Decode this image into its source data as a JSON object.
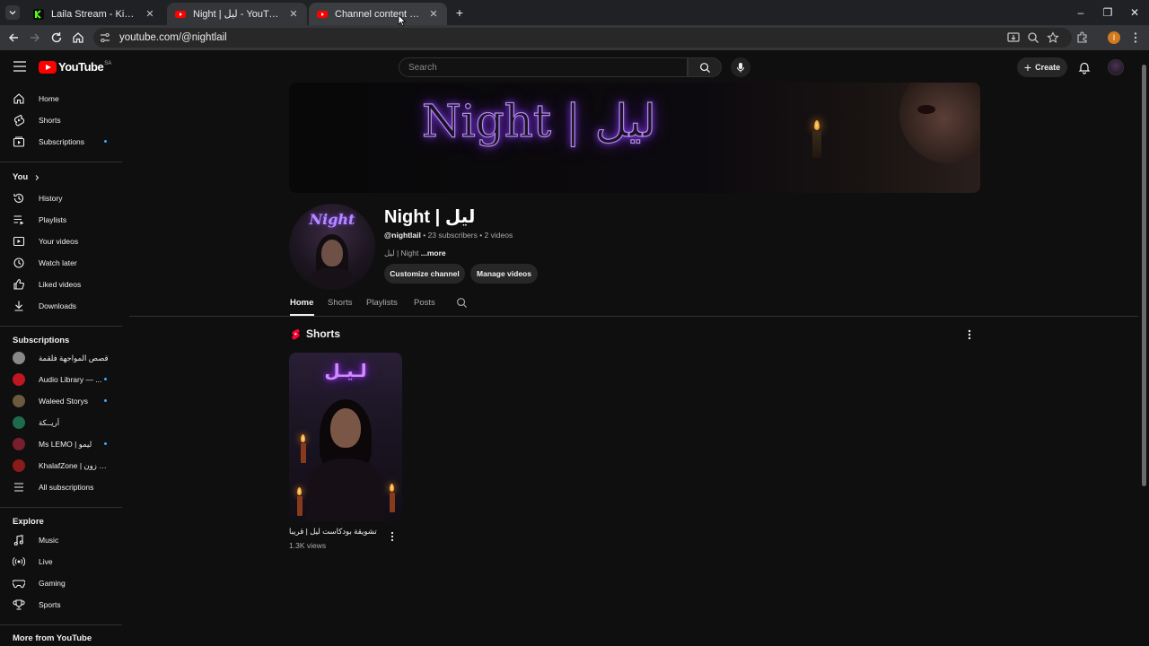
{
  "browser": {
    "tabs": [
      {
        "title": "Laila Stream - Kick Dashboard",
        "favicon": "kick-favicon",
        "color": "#53fc18"
      },
      {
        "title": "Night | ليل - YouTube",
        "favicon": "youtube-favicon",
        "color": "#ff0000"
      },
      {
        "title": "Channel content - YouTube Studio",
        "favicon": "youtube-studio-favicon",
        "color": "#ff0000"
      }
    ],
    "url": "youtube.com/@nightlail",
    "profile_initial": "I"
  },
  "masthead": {
    "logo_text": "YouTube",
    "country_code": "SA",
    "search_placeholder": "Search",
    "create_label": "Create"
  },
  "sidebar": {
    "main": [
      {
        "label": "Home",
        "icon": "home-icon"
      },
      {
        "label": "Shorts",
        "icon": "shorts-icon"
      },
      {
        "label": "Subscriptions",
        "icon": "subscriptions-icon"
      }
    ],
    "you_heading": "You",
    "you": [
      {
        "label": "History",
        "icon": "history-icon"
      },
      {
        "label": "Playlists",
        "icon": "playlists-icon"
      },
      {
        "label": "Your videos",
        "icon": "your-videos-icon"
      },
      {
        "label": "Watch later",
        "icon": "watch-later-icon"
      },
      {
        "label": "Liked videos",
        "icon": "liked-icon"
      },
      {
        "label": "Downloads",
        "icon": "download-icon"
      }
    ],
    "subscriptions_heading": "Subscriptions",
    "subscriptions": [
      {
        "label": "قصص المواجهة فلقمة",
        "color": "#888888"
      },
      {
        "label": "Audio Library — ...",
        "color": "#c0161f"
      },
      {
        "label": "Waleed Storys",
        "color": "#6b5a3e"
      },
      {
        "label": "أريــكة",
        "color": "#1d6b4a"
      },
      {
        "label": "Ms LEMO | ليمو",
        "color": "#7a1d2e"
      },
      {
        "label": "KhalafZone | خلف زون",
        "color": "#8b1a1a"
      }
    ],
    "all_subscriptions": "All subscriptions",
    "explore_heading": "Explore",
    "explore": [
      {
        "label": "Music",
        "icon": "music-icon"
      },
      {
        "label": "Live",
        "icon": "live-icon"
      },
      {
        "label": "Gaming",
        "icon": "gaming-icon"
      },
      {
        "label": "Sports",
        "icon": "trophy-icon"
      }
    ],
    "more_heading": "More from YouTube"
  },
  "channel": {
    "banner_text": "Night | ليل",
    "avatar_text": "Night",
    "title": "Night | ليل",
    "handle": "@nightlail",
    "stats": " • 23 subscribers • 2 videos",
    "description": "ليل | Night",
    "more": " ...more",
    "customize_label": "Customize channel",
    "manage_label": "Manage videos",
    "tabs": [
      "Home",
      "Shorts",
      "Playlists",
      "Posts"
    ]
  },
  "shelf": {
    "title": "Shorts",
    "items": [
      {
        "thumb_text": "لـيـل",
        "title": "تشويقة بودكاست ليل | قريبا",
        "views": "1.3K views"
      }
    ]
  },
  "colors": {
    "background": "#0f0f0f",
    "accent_blue": "#3ea6ff",
    "youtube_red": "#ff0000",
    "neon_purple": "#b388e8"
  }
}
